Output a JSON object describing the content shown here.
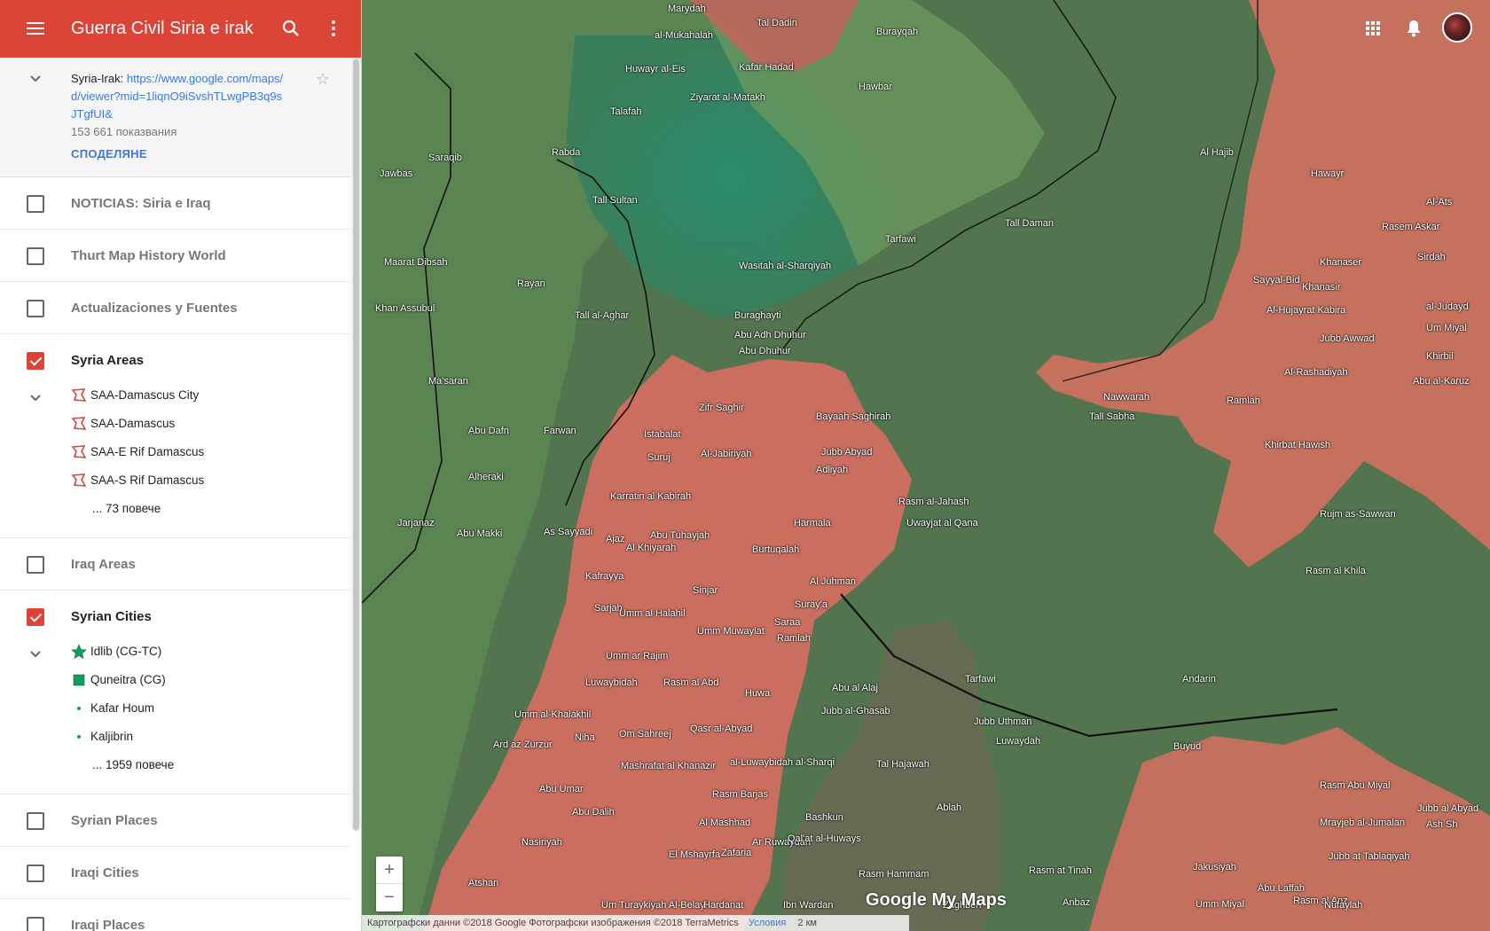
{
  "header": {
    "title": "Guerra Civil Siria e irak"
  },
  "info": {
    "map_name": "Syria-Irak:",
    "link": "https://www.google.com/maps/d/viewer?mid=1liqnO9iSvshTLwgPB3q9sJTgfUI&",
    "views": "153 661 показвания",
    "share": "СПОДЕЛЯНЕ"
  },
  "layers": [
    {
      "label": "NOTICIAS: Siria e Iraq",
      "checked": false
    },
    {
      "label": "Thurt Map History World",
      "checked": false
    },
    {
      "label": "Actualizaciones y Fuentes",
      "checked": false
    },
    {
      "label": "Syria Areas",
      "checked": true,
      "items": [
        "SAA-Damascus City",
        "SAA-Damascus",
        "SAA-E Rif Damascus",
        "SAA-S Rif Damascus"
      ],
      "more": "... 73 повече"
    },
    {
      "label": "Iraq Areas",
      "checked": false
    },
    {
      "label": "Syrian Cities",
      "checked": true,
      "items": [
        "Idlib (CG-TC)",
        "Quneitra (CG)",
        "Kafar Houm",
        "Kaljibrin"
      ],
      "more": "... 1959 повече"
    },
    {
      "label": "Syrian Places",
      "checked": false
    },
    {
      "label": "Iraqi Cities",
      "checked": false
    },
    {
      "label": "Iraqi Places",
      "checked": false
    }
  ],
  "colors": {
    "accent": "#db4437",
    "link": "#3b78e7",
    "saa_area": "#e0756b",
    "rebel_area": "#3f6b45",
    "turkey_area": "#2f8a5c"
  },
  "map": {
    "labels": [
      "Marydah",
      "Tal Dadin",
      "al-Mukahalah",
      "Kafar Hadad",
      "Burayqah",
      "Hawbar",
      "Huwayr al-Eis",
      "Ziyarat al-Matakh",
      "Talafah",
      "Al Hajib",
      "Hawayr",
      "Saraqib",
      "Jawbas",
      "Tall Sultan",
      "Tarfawi",
      "Tall Daman",
      "Rasem Askar",
      "Al-Ats",
      "Wasitah al-Sharqiyah",
      "Khanaser",
      "Sayyal-Bid",
      "Khanasir",
      "Sirdah",
      "Rayan",
      "Tall al-Aghar",
      "Buraghayti",
      "Abu Adh Dhuhur",
      "Abu Dhuhur",
      "Al-Hujayrat Kabira",
      "Jubb Awwad",
      "al-Judayd",
      "Um Miyal",
      "Maarat Dibsah",
      "Khan Assubul",
      "Ma'saran",
      "Zifr Saghir",
      "Bayaah Saghirah",
      "Nawwarah",
      "Ramlah",
      "Al-Rashadiyah",
      "Khirbil",
      "Abu al-Karuz",
      "Tall Sabha",
      "Abu Dafn",
      "Farwan",
      "Istabalat",
      "Suruj",
      "Al-Jabiriyah",
      "Jubb Abyad",
      "Adliyah",
      "Khirbat Hawish",
      "Alheraki",
      "Karratin al Kabirah",
      "Rasm al-Jahash",
      "Uwayjat al Qana",
      "Rujm as-Sawwan",
      "Jarjanaz",
      "Abu Makki",
      "As Sayyadi",
      "Ajaz",
      "Al Khiyarah",
      "Abu Tuhayjah",
      "Harmala",
      "Burtuqalah",
      "Kafrayya",
      "Sinjar",
      "Al Juhman",
      "Suray'a",
      "Rasm al Khila",
      "Sarjah",
      "Umm al Halahil",
      "Umm Muwaylat",
      "Saraa",
      "Ramlah",
      "Umm ar Rajim",
      "Luwaybidah",
      "Rasm al Abd",
      "Huwa",
      "Abu al Alaj",
      "Tarfawi",
      "Andarin",
      "Umm al-Khalakhil",
      "Jubb al-Ghasab",
      "Jubb Uthman",
      "Luwaydah",
      "Niha",
      "Om Sahreej",
      "Qasr al-Abyad",
      "Ard az Zurzur",
      "Buyud",
      "Mashrafat al Khanazir",
      "al-Luwaybidah al-Sharqi",
      "Tal Hajawah",
      "Abu Umar",
      "Rasm Barjas",
      "Ablah",
      "Rasm Abu Miyal",
      "Jubb al Abyad",
      "Abu Dalih",
      "Al Mashhad",
      "Bashkun",
      "Mrayjeb al-Jumalan",
      "Ash Sh",
      "Nasiriyah",
      "Ar Ruwaydah",
      "Qal'at al-Huways",
      "El Mshayrfa",
      "Zafaria",
      "Jubb at Tablaqiyah",
      "Jakusiyah",
      "Atshan",
      "Rasm Hammam",
      "Rasm at Tinah",
      "Abu Laffah",
      "Um Turaykiyah Al-Belayl",
      "Hardanat",
      "Rasm al Anz",
      "Umm Miyal",
      "Nufaylah",
      "Zaghbeh",
      "Anbaz",
      "Ibn Wardan",
      "Rabda"
    ]
  },
  "attribution": {
    "text": "Картографски данни ©2018 Google Фотографски изображения ©2018 TerraMetrics",
    "terms": "Условия",
    "scale": "2 км"
  },
  "logo": "Google My Maps",
  "zoom": {
    "in": "+",
    "out": "−"
  }
}
